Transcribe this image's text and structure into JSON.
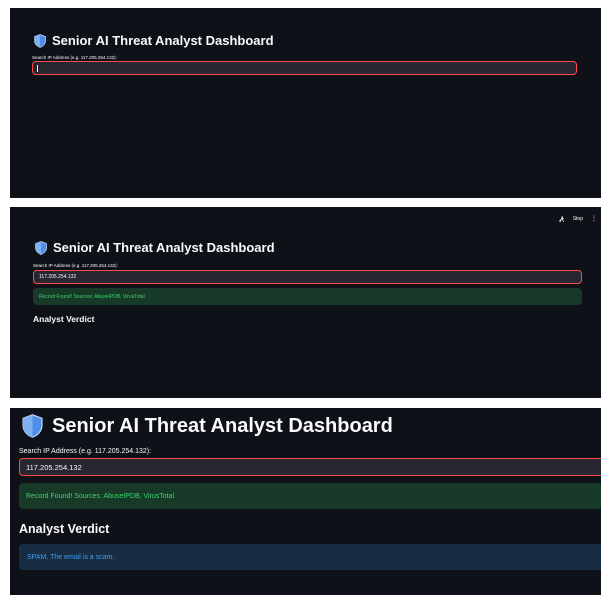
{
  "app": {
    "title": "Senior AI Threat Analyst Dashboard",
    "shield_icon": "shield-icon"
  },
  "search": {
    "label": "Search IP Address (e.g. 117.205.254.132):",
    "value": "117.205.254.132"
  },
  "result": {
    "success_message": "Record Found! Sources: AbuseIPDB, VirusTotal"
  },
  "verdict": {
    "heading": "Analyst Verdict",
    "message": "SPAM. The email is a scam."
  },
  "toolbar": {
    "running_icon": "running-person-icon",
    "stop_label": "Stop",
    "menu_icon": "kebab-menu-icon"
  },
  "colors": {
    "background": "#0e1117",
    "input_bg": "#262730",
    "input_border": "#ff4b4b",
    "success_bg": "#173928",
    "success_text": "#3dd56d",
    "info_bg": "#172d43",
    "info_text": "#3d9df3",
    "shield_blue": "#4d8fe8"
  }
}
